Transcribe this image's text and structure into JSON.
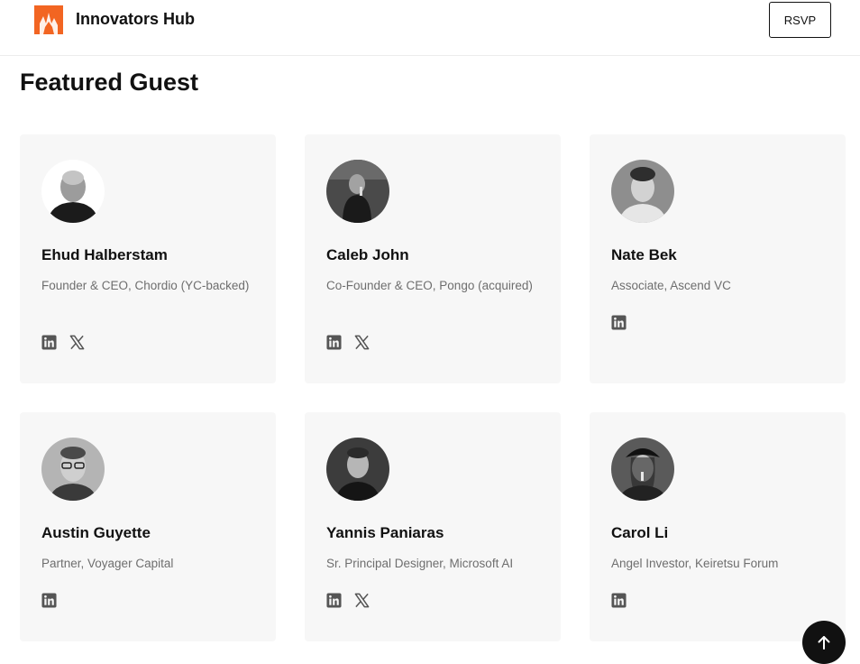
{
  "header": {
    "brand": "Innovators Hub",
    "rsvp_label": "RSVP",
    "accent_color": "#f26522"
  },
  "section": {
    "title": "Featured Guest"
  },
  "guests": [
    {
      "name": "Ehud Halberstam",
      "role": "Founder & CEO, Chordio (YC-backed)",
      "socials": [
        "linkedin-icon",
        "x-icon"
      ]
    },
    {
      "name": "Caleb John",
      "role": "Co-Founder & CEO, Pongo (acquired)",
      "socials": [
        "linkedin-icon",
        "x-icon"
      ]
    },
    {
      "name": "Nate Bek",
      "role": "Associate, Ascend VC",
      "socials": [
        "linkedin-icon"
      ]
    },
    {
      "name": "Austin Guyette",
      "role": "Partner, Voyager Capital",
      "socials": [
        "linkedin-icon"
      ]
    },
    {
      "name": "Yannis Paniaras",
      "role": "Sr. Principal Designer, Microsoft AI",
      "socials": [
        "linkedin-icon",
        "x-icon"
      ]
    },
    {
      "name": "Carol Li",
      "role": "Angel Investor, Keiretsu Forum",
      "socials": [
        "linkedin-icon"
      ]
    }
  ],
  "scroll_top": {
    "icon": "arrow-up-icon"
  }
}
